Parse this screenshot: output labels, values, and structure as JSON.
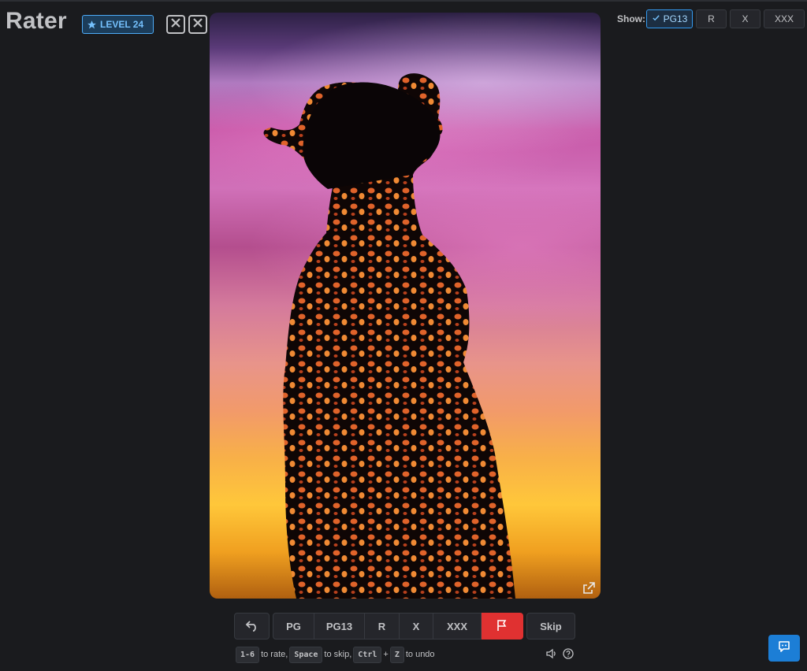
{
  "app": {
    "title": "Rater"
  },
  "header": {
    "level_label": "LEVEL 24",
    "strikes": [
      "strike-1",
      "strike-2",
      "strike-3"
    ]
  },
  "filters": {
    "label": "Show:",
    "options": [
      {
        "label": "PG13",
        "active": true
      },
      {
        "label": "R",
        "active": false
      },
      {
        "label": "X",
        "active": false
      },
      {
        "label": "XXX",
        "active": false
      }
    ]
  },
  "rating": {
    "buttons": [
      "PG",
      "PG13",
      "R",
      "X",
      "XXX"
    ],
    "skip_label": "Skip"
  },
  "hints": {
    "key_rate": "1-6",
    "text_rate": "to rate,",
    "key_skip": "Space",
    "text_skip": "to skip,",
    "key_ctrl": "Ctrl",
    "plus": "+",
    "key_z": "Z",
    "text_undo": "to undo"
  },
  "icons": {
    "level": "star-icon",
    "strike": "x-icon",
    "crown": "crown-icon",
    "open_external": "external-link-icon",
    "undo": "undo-arrow-icon",
    "flag": "flag-icon",
    "sound": "speaker-icon",
    "help": "question-icon",
    "chat": "chat-icon"
  },
  "colors": {
    "accent": "#4dabf7",
    "flag": "#e03131",
    "chat": "#1c7ed6"
  }
}
